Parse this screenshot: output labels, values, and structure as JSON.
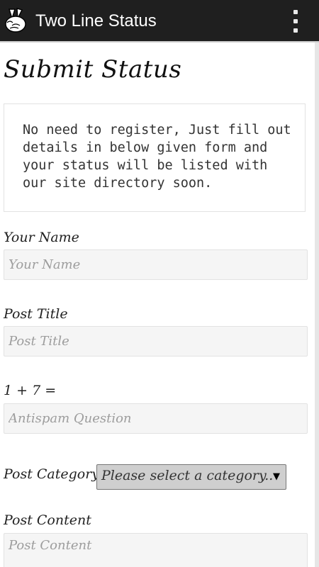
{
  "app": {
    "title": "Two Line Status",
    "logo_icon": "peace-hand-icon",
    "menu_icon": "overflow-menu-icon"
  },
  "page": {
    "heading": "Submit Status",
    "notice": "No need to register, Just fill out details in below given form and your status will be listed with our site directory soon."
  },
  "form": {
    "name": {
      "label": "Your Name",
      "placeholder": "Your Name",
      "value": ""
    },
    "title": {
      "label": "Post Title",
      "placeholder": "Post Title",
      "value": ""
    },
    "antispam": {
      "label": "1 + 7 =",
      "placeholder": "Antispam Question",
      "value": ""
    },
    "category": {
      "label": "Post Category",
      "selected": "Please select a category..",
      "arrow": "▼"
    },
    "content": {
      "label": "Post Content",
      "placeholder": "Post Content",
      "value": ""
    }
  },
  "colors": {
    "appbar_bg": "#1f1f1f",
    "field_bg": "#f5f5f5",
    "select_bg": "#cfcfcf"
  }
}
